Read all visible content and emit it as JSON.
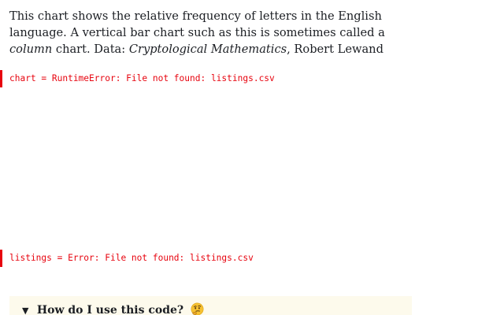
{
  "intro": {
    "part1": "This chart shows the relative frequency of letters in the English language. A vertical bar chart such as this is sometimes called a ",
    "emphasis1": "column",
    "part2": " chart. Data: ",
    "emphasis2": "Cryptological Mathematics",
    "part3": ", Robert Lewand"
  },
  "errors": {
    "chart": "chart = RuntimeError: File not found: listings.csv",
    "listings": "listings = Error: File not found: listings.csv"
  },
  "help": {
    "triangle": "▼",
    "summary_text": "How do I use this code?",
    "emoji_icon": "thinking-face"
  },
  "colors": {
    "error": "#e7040f",
    "help_background": "#fdfaec"
  }
}
